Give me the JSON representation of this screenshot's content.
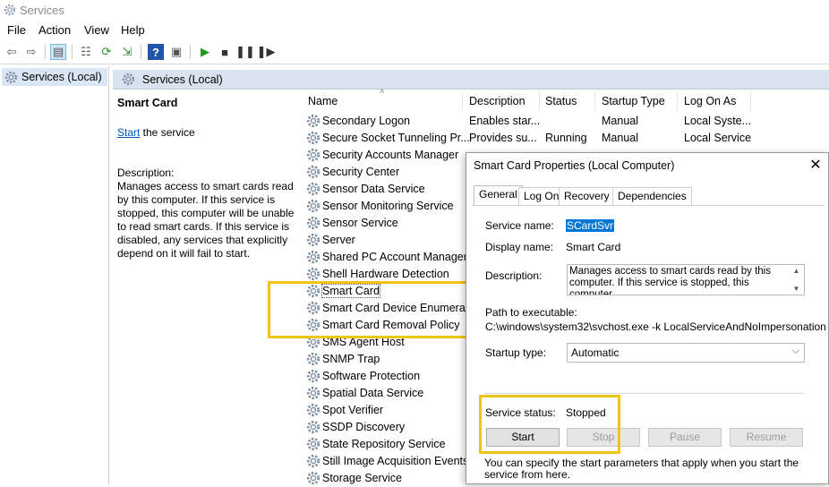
{
  "window": {
    "title": "Services"
  },
  "menu": [
    "File",
    "Action",
    "View",
    "Help"
  ],
  "toolbar": {
    "icons": [
      "back-icon",
      "forward-icon",
      "show-tree-icon",
      "properties-icon",
      "refresh-icon",
      "export-icon",
      "help-icon",
      "console-icon",
      "play-icon",
      "stop-icon",
      "pause-icon",
      "restart-icon"
    ]
  },
  "tree": {
    "item": "Services (Local)"
  },
  "panel": {
    "title": "Services (Local)"
  },
  "details": {
    "service_title": "Smart Card",
    "start_link": "Start",
    "start_suffix": " the service",
    "description_label": "Description:",
    "description": "Manages access to smart cards read by this computer. If this service is stopped, this computer will be unable to read smart cards. If this service is disabled, any services that explicitly depend on it will fail to start."
  },
  "columns": {
    "name": "Name",
    "description": "Description",
    "status": "Status",
    "startup": "Startup Type",
    "logon": "Log On As"
  },
  "services": [
    {
      "name": "Secondary Logon",
      "description": "Enables star...",
      "status": "",
      "startup": "Manual",
      "logon": "Local Syste..."
    },
    {
      "name": "Secure Socket Tunneling Pr...",
      "description": "Provides su...",
      "status": "Running",
      "startup": "Manual",
      "logon": "Local Service"
    },
    {
      "name": "Security Accounts Manager"
    },
    {
      "name": "Security Center"
    },
    {
      "name": "Sensor Data Service"
    },
    {
      "name": "Sensor Monitoring Service"
    },
    {
      "name": "Sensor Service"
    },
    {
      "name": "Server"
    },
    {
      "name": "Shared PC Account Manager"
    },
    {
      "name": "Shell Hardware Detection"
    },
    {
      "name": "Smart Card"
    },
    {
      "name": "Smart Card Device Enumera..."
    },
    {
      "name": "Smart Card Removal Policy"
    },
    {
      "name": "SMS Agent Host"
    },
    {
      "name": "SNMP Trap"
    },
    {
      "name": "Software Protection"
    },
    {
      "name": "Spatial Data Service"
    },
    {
      "name": "Spot Verifier"
    },
    {
      "name": "SSDP Discovery"
    },
    {
      "name": "State Repository Service"
    },
    {
      "name": "Still Image Acquisition Events"
    },
    {
      "name": "Storage Service"
    }
  ],
  "dialog": {
    "title": "Smart Card Properties (Local Computer)",
    "tabs": [
      "General",
      "Log On",
      "Recovery",
      "Dependencies"
    ],
    "service_name_label": "Service name:",
    "service_name": "SCardSvr",
    "display_name_label": "Display name:",
    "display_name": "Smart Card",
    "description_label": "Description:",
    "description": "Manages access to smart cards read by this computer. If this service is stopped, this computer",
    "path_label": "Path to executable:",
    "path": "C:\\windows\\system32\\svchost.exe -k LocalServiceAndNoImpersonation",
    "startup_label": "Startup type:",
    "startup_value": "Automatic",
    "status_label": "Service status:",
    "status_value": "Stopped",
    "buttons": {
      "start": "Start",
      "stop": "Stop",
      "pause": "Pause",
      "resume": "Resume"
    },
    "note": "You can specify the start parameters that apply when you start the service from here."
  },
  "colors": {
    "highlight": "#f2c417",
    "selection": "#0078d7",
    "panel_header": "#d9e3ef"
  }
}
